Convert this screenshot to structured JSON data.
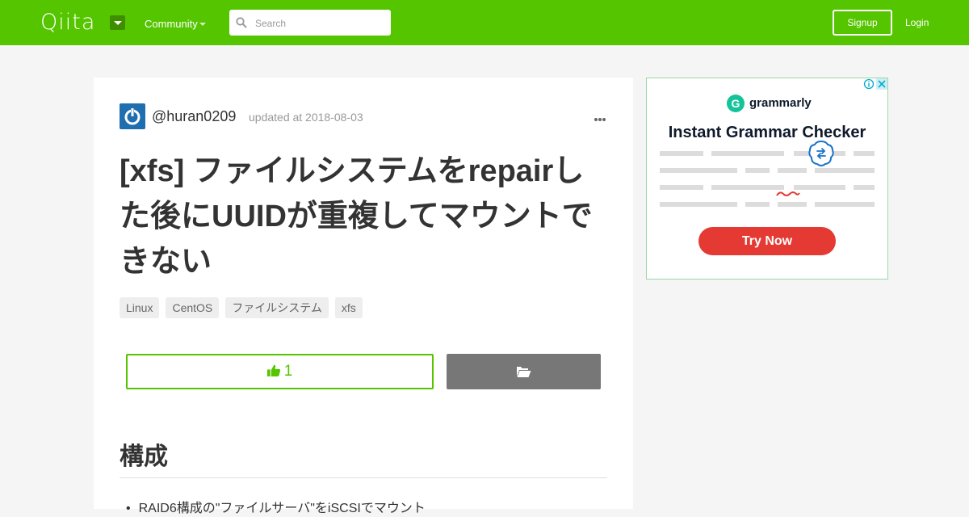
{
  "header": {
    "logo_text": "Qiita",
    "community_label": "Community",
    "search_placeholder": "Search",
    "signup_label": "Signup",
    "login_label": "Login",
    "brand_color": "#55c500"
  },
  "article": {
    "author": "@huran0209",
    "updated": "updated at 2018-08-03",
    "title": "[xfs] ファイルシステムをrepairした後にUUIDが重複してマウントできない",
    "tags": [
      "Linux",
      "CentOS",
      "ファイルシステム",
      "xfs"
    ],
    "like_count": "1",
    "section_heading": "構成",
    "list_items": [
      "RAID6構成の\"ファイルサーバ\"をiSCSIでマウント"
    ]
  },
  "ad": {
    "brand": "grammarly",
    "logo_letter": "G",
    "headline": "Instant Grammar Checker",
    "cta": "Try Now",
    "accent_color": "#e53a33"
  }
}
